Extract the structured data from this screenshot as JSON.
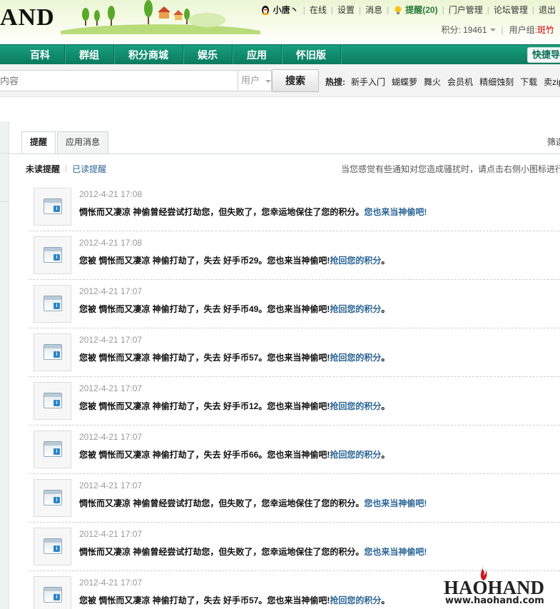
{
  "site": {
    "logo_text": "AND"
  },
  "user_bar": {
    "username": "小唐丶",
    "links": [
      "在线",
      "设置",
      "消息"
    ],
    "reminder": "提醒(20)",
    "admin_links": [
      "门户管理",
      "论坛管理",
      "退出"
    ],
    "points_label": "积分: 19461",
    "group_label": "用户组: ",
    "group_value": "斑竹"
  },
  "nav": {
    "items": [
      "百科",
      "群组",
      "积分商城",
      "娱乐",
      "应用",
      "怀旧版"
    ],
    "quick_label": "快捷导"
  },
  "search": {
    "placeholder": "内容",
    "type_selected": "用户",
    "button_label": "搜索",
    "hot_label": "热搜:",
    "hot_links": [
      "新手入门",
      "蝴蝶萝",
      "舞火",
      "会员机",
      "精细蚀刻",
      "下载",
      "卖zip"
    ]
  },
  "tabs": [
    "提醒",
    "应用消息"
  ],
  "filter_label": "筛选",
  "subtabs": {
    "unread": "未读提醒",
    "read": "已读提醒"
  },
  "tip": "当您感觉有些通知对您造成骚扰时，请点击右侧小图标进行",
  "notices": [
    {
      "time": "2012-4-21 17:08",
      "text": "惆怅而又凄凉 神偷曾经尝试打劫您，但失败了，您幸运地保住了您的积分。",
      "action": "您也来当神偷吧!",
      "suffix": ""
    },
    {
      "time": "2012-4-21 17:08",
      "text": "您被 惆怅而又凄凉 神偷打劫了，失去 好手币29。您也来当神偷吧!",
      "action": "抢回您的积分",
      "suffix": "。"
    },
    {
      "time": "2012-4-21 17:07",
      "text": "您被 惆怅而又凄凉 神偷打劫了，失去 好手币49。您也来当神偷吧!",
      "action": "抢回您的积分",
      "suffix": "。"
    },
    {
      "time": "2012-4-21 17:07",
      "text": "您被 惆怅而又凄凉 神偷打劫了，失去 好手币57。您也来当神偷吧!",
      "action": "抢回您的积分",
      "suffix": "。"
    },
    {
      "time": "2012-4-21 17:07",
      "text": "您被 惆怅而又凄凉 神偷打劫了，失去 好手币12。您也来当神偷吧!",
      "action": "抢回您的积分",
      "suffix": "。"
    },
    {
      "time": "2012-4-21 17:07",
      "text": "您被 惆怅而又凄凉 神偷打劫了，失去 好手币66。您也来当神偷吧!",
      "action": "抢回您的积分",
      "suffix": "。"
    },
    {
      "time": "2012-4-21 17:07",
      "text": "惆怅而又凄凉 神偷曾经尝试打劫您，但失败了，您幸运地保住了您的积分。",
      "action": "您也来当神偷吧!",
      "suffix": ""
    },
    {
      "time": "2012-4-21 17:07",
      "text": "惆怅而又凄凉 神偷曾经尝试打劫您，但失败了，您幸运地保住了您的积分。",
      "action": "您也来当神偷吧!",
      "suffix": ""
    },
    {
      "time": "2012-4-21 17:07",
      "text": "您被 惆怅而又凄凉 神偷打劫了，失去 好手币57。您也来当神偷吧!",
      "action": "抢回您的积分",
      "suffix": "。"
    }
  ],
  "watermark": {
    "logo": "HAOHAND",
    "url": "www.haohand.com"
  }
}
